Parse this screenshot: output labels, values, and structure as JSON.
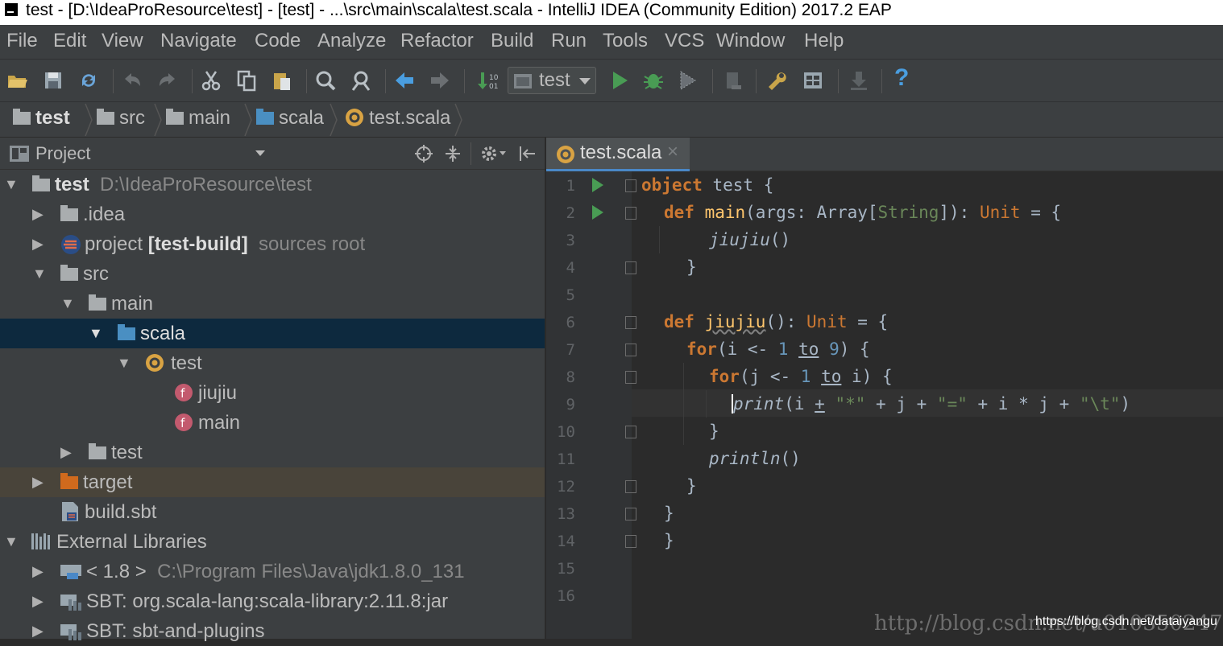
{
  "window": {
    "title": "test - [D:\\IdeaProResource\\test] - [test] - ...\\src\\main\\scala\\test.scala - IntelliJ IDEA (Community Edition) 2017.2 EAP"
  },
  "menu": [
    "File",
    "Edit",
    "View",
    "Navigate",
    "Code",
    "Analyze",
    "Refactor",
    "Build",
    "Run",
    "Tools",
    "VCS",
    "Window",
    "Help"
  ],
  "toolbar": {
    "run_config": "test",
    "help": "?"
  },
  "breadcrumb": [
    "test",
    "src",
    "main",
    "scala",
    "test.scala"
  ],
  "project_panel": {
    "title": "Project",
    "tree": [
      {
        "label": "test",
        "detail": "D:\\IdeaProResource\\test",
        "kind": "module",
        "expanded": true
      },
      {
        "label": ".idea",
        "kind": "folder",
        "expanded": false
      },
      {
        "label": "project",
        "bold": "[test-build]",
        "detail": "sources root",
        "kind": "sbt-folder",
        "expanded": false
      },
      {
        "label": "src",
        "kind": "folder",
        "expanded": true
      },
      {
        "label": "main",
        "kind": "folder",
        "expanded": true
      },
      {
        "label": "scala",
        "kind": "source-folder",
        "expanded": true,
        "selected": true
      },
      {
        "label": "test",
        "kind": "object",
        "expanded": true
      },
      {
        "label": "jiujiu",
        "kind": "function"
      },
      {
        "label": "main",
        "kind": "function"
      },
      {
        "label": "test",
        "kind": "folder",
        "expanded": false
      },
      {
        "label": "target",
        "kind": "excluded-folder",
        "expanded": false
      },
      {
        "label": "build.sbt",
        "kind": "file"
      },
      {
        "label": "External Libraries",
        "kind": "libraries",
        "expanded": true
      },
      {
        "label": "< 1.8 >",
        "detail": "C:\\Program Files\\Java\\jdk1.8.0_131",
        "kind": "jdk",
        "expanded": false
      },
      {
        "label": "SBT: org.scala-lang:scala-library:2.11.8:jar",
        "kind": "library",
        "expanded": false
      },
      {
        "label": "SBT: sbt-and-plugins",
        "kind": "library",
        "expanded": false
      }
    ]
  },
  "editor": {
    "tab": "test.scala",
    "close": "×",
    "line_numbers": [
      "1",
      "2",
      "3",
      "4",
      "5",
      "6",
      "7",
      "8",
      "9",
      "10",
      "11",
      "12",
      "13",
      "14",
      "15",
      "16"
    ],
    "code": {
      "l1_kw": "object",
      "l1_rest": " test {",
      "l2_kw": "def",
      "l2_name": " main",
      "l2_a": "(args: Array[",
      "l2_str": "String",
      "l2_b": "]): ",
      "l2_unit": "Unit",
      "l2_c": " = {",
      "l3": "jiujiu",
      "l3_b": "()",
      "l4": "}",
      "l6_kw": "def",
      "l6_name": "jiujiu",
      "l6_a": "(): ",
      "l6_unit": "Unit",
      "l6_b": " = {",
      "l7_kw": "for",
      "l7_a": "(i <- ",
      "l7_n1": "1",
      "l7_to": "to",
      "l7_n2": "9",
      "l7_b": ") {",
      "l8_kw": "for",
      "l8_a": "(j <- ",
      "l8_n1": "1",
      "l8_to": "to",
      "l8_b": " i) {",
      "l9_fn": "print",
      "l9_a": "(i ",
      "l9_plus": "+",
      "l9_b": " ",
      "l9_s1": "\"*\"",
      "l9_c": " + j + ",
      "l9_s2": "\"=\"",
      "l9_d": " + i * j + ",
      "l9_s3": "\"\\t\"",
      "l9_e": ")",
      "l10": "}",
      "l11_fn": "println",
      "l11_a": "()",
      "l12": "}",
      "l13": "}",
      "l14": "}"
    }
  },
  "watermark": {
    "back": "http://blog.csdn.net/u010350247",
    "front": "https://blog.csdn.net/dataiyangu"
  },
  "colors": {
    "selection": "#0d293e",
    "keyword": "#cc7832",
    "number": "#6897bb",
    "string": "#6a8759",
    "run": "#499c54"
  }
}
